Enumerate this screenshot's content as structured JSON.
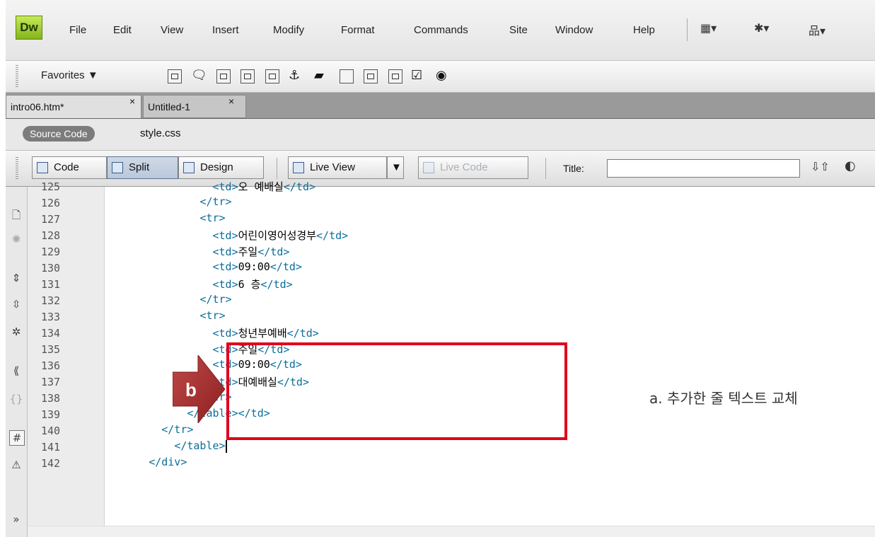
{
  "app": {
    "logo": "Dw"
  },
  "menubar": {
    "items": [
      "File",
      "Edit",
      "View",
      "Insert",
      "Modify",
      "Format",
      "Commands",
      "Site",
      "Window",
      "Help"
    ],
    "icons": [
      "layout-icon",
      "gear-icon",
      "site-icon"
    ],
    "dropdown_arrow": "▾"
  },
  "insertbar": {
    "favorites_label": "Favorites ▼",
    "icons": [
      "list-icon",
      "comment-icon",
      "table-icon",
      "image-icon",
      "rollover-image-icon",
      "anchor-icon",
      "flash-icon",
      "form-icon",
      "text-field-icon",
      "textarea-icon",
      "checkbox-icon",
      "radio-icon"
    ]
  },
  "tabs": [
    {
      "label": "intro06.htm*",
      "close": "×"
    },
    {
      "label": "Untitled-1",
      "close": "×"
    }
  ],
  "related_files": {
    "source_code": "Source Code",
    "file": "style.css"
  },
  "doc_toolbar": {
    "code": "Code",
    "split": "Split",
    "design": "Design",
    "live_view": "Live View",
    "live_code": "Live Code",
    "title_label": "Title:",
    "title_value": ""
  },
  "code": {
    "lines": [
      {
        "num": "125",
        "indent": "                ",
        "parts": [
          [
            "tag",
            "<td>"
          ],
          [
            "txt",
            "오 예배실"
          ],
          [
            "tag",
            "</td>"
          ]
        ]
      },
      {
        "num": "126",
        "indent": "              ",
        "parts": [
          [
            "tag",
            "</tr>"
          ]
        ]
      },
      {
        "num": "127",
        "indent": "              ",
        "parts": [
          [
            "tag",
            "<tr>"
          ]
        ]
      },
      {
        "num": "128",
        "indent": "                ",
        "parts": [
          [
            "tag",
            "<td>"
          ],
          [
            "txt",
            "어린이영어성경부"
          ],
          [
            "tag",
            "</td>"
          ]
        ]
      },
      {
        "num": "129",
        "indent": "                ",
        "parts": [
          [
            "tag",
            "<td>"
          ],
          [
            "txt",
            "주일"
          ],
          [
            "tag",
            "</td>"
          ]
        ]
      },
      {
        "num": "130",
        "indent": "                ",
        "parts": [
          [
            "tag",
            "<td>"
          ],
          [
            "txt",
            "09:00"
          ],
          [
            "tag",
            "</td>"
          ]
        ]
      },
      {
        "num": "131",
        "indent": "                ",
        "parts": [
          [
            "tag",
            "<td>"
          ],
          [
            "txt",
            "6 층"
          ],
          [
            "tag",
            "</td>"
          ]
        ]
      },
      {
        "num": "132",
        "indent": "              ",
        "parts": [
          [
            "tag",
            "</tr>"
          ]
        ]
      },
      {
        "num": "133",
        "indent": "              ",
        "parts": [
          [
            "tag",
            "<tr>"
          ]
        ]
      },
      {
        "num": "134",
        "indent": "                ",
        "parts": [
          [
            "tag",
            "<td>"
          ],
          [
            "txt",
            "청년부예배"
          ],
          [
            "tag",
            "</td>"
          ]
        ]
      },
      {
        "num": "135",
        "indent": "                ",
        "parts": [
          [
            "tag",
            "<td>"
          ],
          [
            "txt",
            "주일"
          ],
          [
            "tag",
            "</td>"
          ]
        ]
      },
      {
        "num": "136",
        "indent": "                ",
        "parts": [
          [
            "tag",
            "<td>"
          ],
          [
            "txt",
            "09:00"
          ],
          [
            "tag",
            "</td>"
          ]
        ]
      },
      {
        "num": "137",
        "indent": "                ",
        "parts": [
          [
            "tag",
            "<td>"
          ],
          [
            "txt",
            "대예배실"
          ],
          [
            "tag",
            "</td>"
          ]
        ]
      },
      {
        "num": "138",
        "indent": "              ",
        "parts": [
          [
            "tag",
            "</tr>"
          ]
        ]
      },
      {
        "num": "139",
        "indent": "            ",
        "parts": [
          [
            "tag",
            "</table></td>"
          ]
        ]
      },
      {
        "num": "140",
        "indent": "        ",
        "parts": [
          [
            "tag",
            "</tr>"
          ]
        ]
      },
      {
        "num": "141",
        "indent": "          ",
        "parts": [
          [
            "tag",
            "</table>"
          ]
        ],
        "caret": true
      },
      {
        "num": "142",
        "indent": "      ",
        "parts": [
          [
            "tag",
            "</div>"
          ]
        ]
      }
    ]
  },
  "annotations": {
    "badge": "b",
    "note": "a.  추가한 줄 텍스트 교체"
  }
}
